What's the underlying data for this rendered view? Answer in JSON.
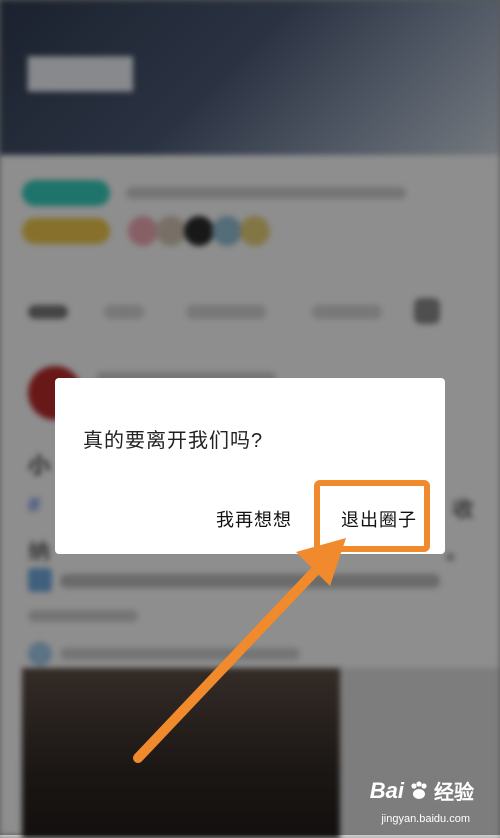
{
  "dialog": {
    "message": "真的要离开我们吗?",
    "think_again_label": "我再想想",
    "quit_label": "退出圈子"
  },
  "background": {
    "post_title_fragment": "小",
    "post_body_hash_fragment": "#",
    "post_body_right_fragment": "收",
    "post_body_line2_fragment": "纳",
    "post_body_right_fragment2": "。"
  },
  "colors": {
    "highlight": "#f08a2c",
    "arrow": "#f08a2c",
    "tag_teal": "#35c9b8",
    "tag_yellow": "#e7c24a"
  },
  "watermark": {
    "brand": "Bai",
    "brand_suffix": "经验",
    "url": "jingyan.baidu.com"
  }
}
